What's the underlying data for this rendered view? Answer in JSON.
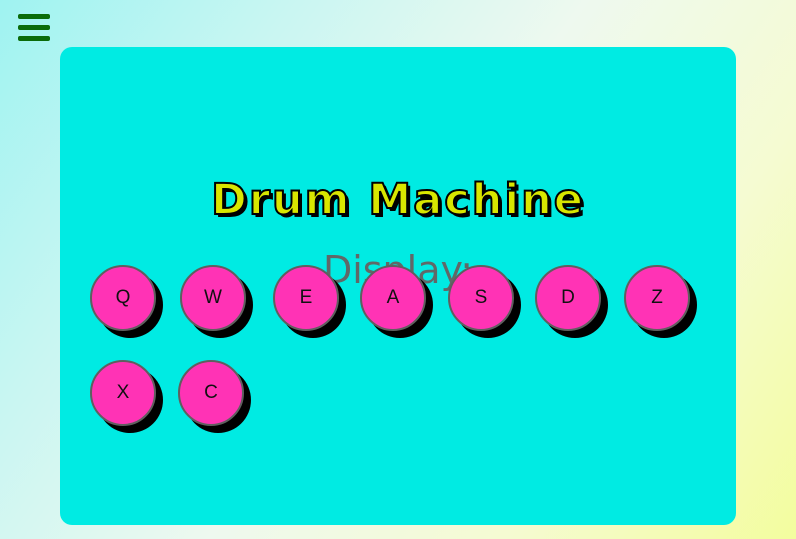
{
  "menu": {
    "icon": "hamburger-menu-icon"
  },
  "machine": {
    "title": "Drum Machine",
    "display_label": "Display:",
    "pads": [
      "Q",
      "W",
      "E",
      "A",
      "S",
      "D",
      "Z",
      "X",
      "C"
    ]
  },
  "colors": {
    "panel": "#00ebe3",
    "pad": "#ff33b5",
    "title": "#d8e600",
    "menu": "#0a6b0a",
    "display_text": "#606868"
  }
}
